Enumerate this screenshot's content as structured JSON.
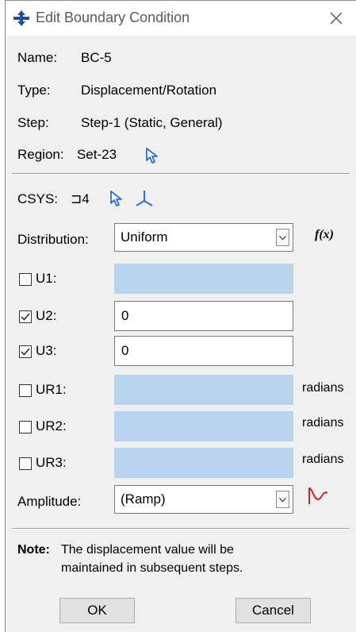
{
  "window": {
    "title": "Edit Boundary Condition",
    "icon": "boundary-condition-icon",
    "close_icon": "close-icon"
  },
  "info": {
    "name_label": "Name:",
    "name_value": "BC-5",
    "type_label": "Type:",
    "type_value": "Displacement/Rotation",
    "step_label": "Step:",
    "step_value": "Step-1 (Static, General)",
    "region_label": "Region:",
    "region_value": "Set-23"
  },
  "csys": {
    "label": "CSYS:",
    "value": "⊐4",
    "pick_icon": "select-arrow-icon",
    "create_icon": "axis-triad-icon"
  },
  "distribution": {
    "label": "Distribution:",
    "selected": "Uniform",
    "fx_label": "f(x)"
  },
  "dofs": [
    {
      "label": "U1:",
      "checked": false,
      "value": "",
      "unit": ""
    },
    {
      "label": "U2:",
      "checked": true,
      "value": "0",
      "unit": ""
    },
    {
      "label": "U3:",
      "checked": true,
      "value": "0",
      "unit": ""
    },
    {
      "label": "UR1:",
      "checked": false,
      "value": "",
      "unit": "radians"
    },
    {
      "label": "UR2:",
      "checked": false,
      "value": "",
      "unit": "radians"
    },
    {
      "label": "UR3:",
      "checked": false,
      "value": "",
      "unit": "radians"
    }
  ],
  "amplitude": {
    "label": "Amplitude:",
    "selected": "(Ramp)",
    "create_icon": "amplitude-curve-icon"
  },
  "note": {
    "label": "Note:",
    "line1": "The displacement value will be",
    "line2": "maintained in subsequent steps."
  },
  "buttons": {
    "ok": "OK",
    "cancel": "Cancel"
  },
  "colors": {
    "disabled_field": "#b7d3ee",
    "icon_blue": "#2a6fd6",
    "amplitude_red": "#d0202a"
  }
}
